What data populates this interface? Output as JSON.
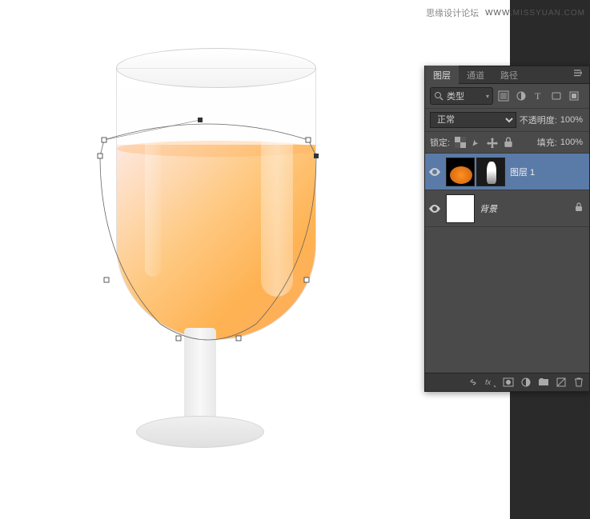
{
  "watermark": {
    "text": "思缘设计论坛",
    "url": "WWW.MISSYUAN.COM"
  },
  "tabs": {
    "layers": "图层",
    "channels": "通道",
    "paths": "路径"
  },
  "filter": {
    "kind": "类型"
  },
  "blend": {
    "mode": "正常",
    "opacity_label": "不透明度:",
    "opacity_value": "100%"
  },
  "lock": {
    "label": "锁定:",
    "fill_label": "填充:",
    "fill_value": "100%"
  },
  "layers": [
    {
      "name": "图层 1"
    },
    {
      "name": "背景"
    }
  ]
}
